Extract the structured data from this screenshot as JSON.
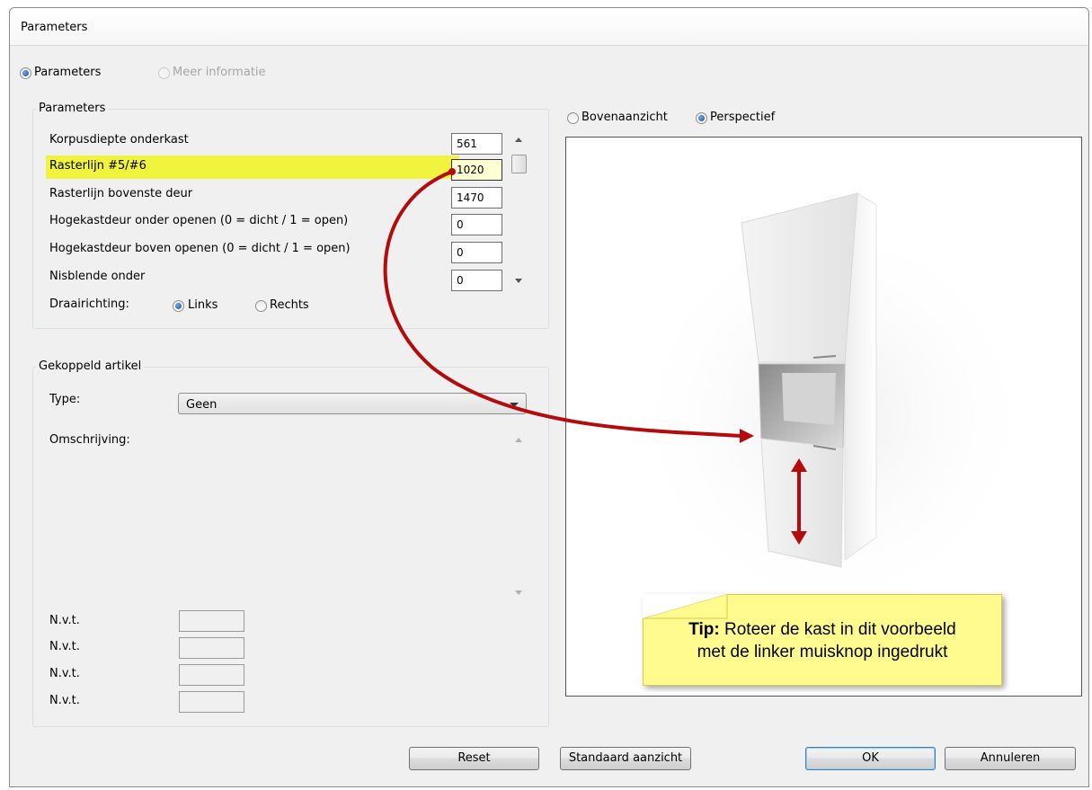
{
  "window": {
    "title": "Parameters"
  },
  "mode_tabs": [
    {
      "label": "Parameters",
      "checked": true,
      "enabled": true
    },
    {
      "label": "Meer informatie",
      "checked": false,
      "enabled": false
    }
  ],
  "params_group": {
    "title": "Parameters",
    "rows": [
      {
        "label": "Korpusdiepte onderkast",
        "value": "561"
      },
      {
        "label": "Rasterlijn #5/#6",
        "value": "1020",
        "highlighted": true
      },
      {
        "label": "Rasterlijn bovenste deur",
        "value": "1470"
      },
      {
        "label": "Hogekastdeur onder openen (0 = dicht / 1 = open)",
        "value": "0"
      },
      {
        "label": "Hogekastdeur boven openen (0 = dicht / 1 = open)",
        "value": "0"
      },
      {
        "label": "Nisblende onder",
        "value": "0"
      }
    ],
    "draairichting": {
      "label": "Draairichting:",
      "options": [
        {
          "label": "Links",
          "checked": true
        },
        {
          "label": "Rechts",
          "checked": false
        }
      ]
    }
  },
  "linked_group": {
    "title": "Gekoppeld artikel",
    "type_label": "Type:",
    "type_value": "Geen",
    "description_label": "Omschrijving:",
    "nvt_rows": [
      "N.v.t.",
      "N.v.t.",
      "N.v.t.",
      "N.v.t."
    ]
  },
  "view_options": [
    {
      "label": "Bovenaanzicht",
      "checked": false
    },
    {
      "label": "Perspectief",
      "checked": true
    }
  ],
  "tip": {
    "bold": "Tip:",
    "line1": " Roteer de kast in dit voorbeeld",
    "line2": "met de linker muisknop ingedrukt"
  },
  "buttons": {
    "reset": "Reset",
    "standaard": "Standaard aanzicht",
    "ok": "OK",
    "cancel": "Annuleren"
  },
  "colors": {
    "highlight": "#f1f43c",
    "arrow": "#b40c0c",
    "tip_background": "#fffb8f"
  }
}
